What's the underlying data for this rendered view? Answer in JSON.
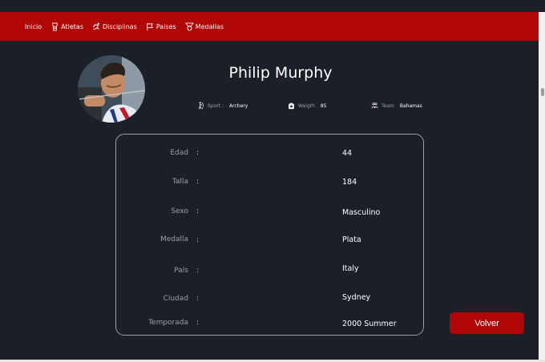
{
  "nav": {
    "items": [
      {
        "label": "Inicio",
        "icon": null
      },
      {
        "label": "Atletas",
        "icon": "athlete-badge-icon"
      },
      {
        "label": "Disciplinas",
        "icon": "running-icon"
      },
      {
        "label": "Paises",
        "icon": "flag-icon"
      },
      {
        "label": "Medallas",
        "icon": "medal-icon"
      }
    ]
  },
  "profile": {
    "name": "Philip Murphy",
    "sport_label": "Sport :",
    "sport": "Archery",
    "weight_label": "Weigth",
    "weight": "85",
    "team_label": "Team",
    "team": "Bahamas"
  },
  "details": [
    {
      "label": "Edad",
      "value": "44"
    },
    {
      "label": "Talla",
      "value": "184"
    },
    {
      "label": "Sexo",
      "value": "Masculino"
    },
    {
      "label": "Medalla",
      "value": "Plata"
    },
    {
      "label": "País",
      "value": "Italy"
    },
    {
      "label": "Ciudad",
      "value": "Sydney"
    },
    {
      "label": "Temporada",
      "value": "2000 Summer"
    }
  ],
  "colon": ":",
  "back_button": "Volver",
  "colors": {
    "accent": "#b00606",
    "background": "#1b1f27",
    "muted_text": "#9aa0a8"
  }
}
